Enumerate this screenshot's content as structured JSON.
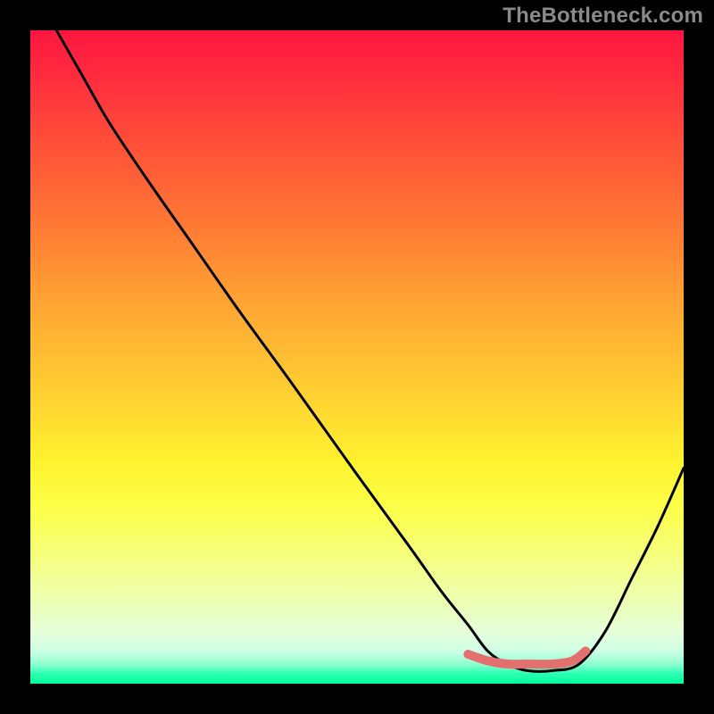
{
  "watermark": "TheBottleneck.com",
  "chart_data": {
    "type": "line",
    "title": "",
    "xlabel": "",
    "ylabel": "",
    "xlim": [
      0,
      100
    ],
    "ylim": [
      0,
      100
    ],
    "grid": false,
    "legend": false,
    "background": "red-yellow-green-vertical-gradient",
    "series": [
      {
        "name": "bottleneck-curve",
        "color": "#000000",
        "x": [
          4,
          8,
          12,
          18,
          25,
          32,
          40,
          50,
          58,
          63,
          67,
          70,
          73,
          76,
          80,
          84,
          88,
          92,
          96,
          100
        ],
        "y": [
          100,
          93,
          86,
          77,
          67,
          57,
          46,
          32,
          21,
          14,
          9,
          5,
          3,
          2,
          2,
          3,
          8,
          16,
          24,
          33
        ]
      },
      {
        "name": "highlight-segment",
        "color": "#e46f6f",
        "stroke_width": 10,
        "x": [
          67,
          70,
          73,
          76,
          80,
          83,
          85
        ],
        "y": [
          4.5,
          3.5,
          3,
          3,
          3,
          3.5,
          5
        ]
      }
    ],
    "annotations": []
  }
}
